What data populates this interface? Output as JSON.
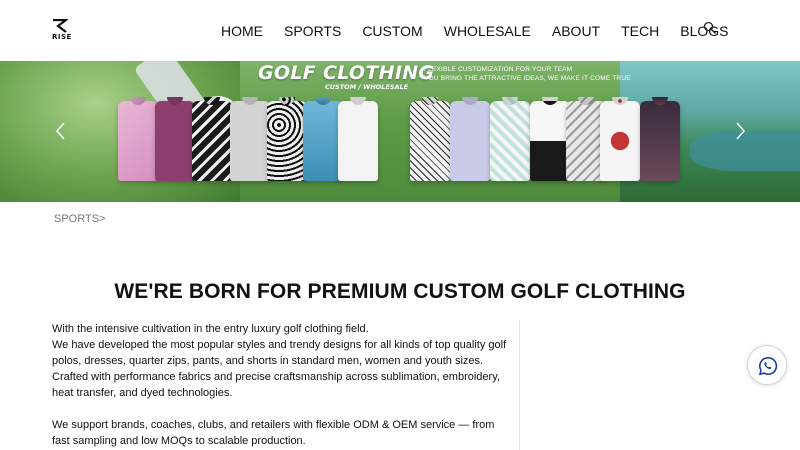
{
  "header": {
    "logo_text": "RISE",
    "nav": [
      "HOME",
      "SPORTS",
      "CUSTOM",
      "WHOLESALE",
      "ABOUT",
      "TECH",
      "BLOGS"
    ],
    "search_icon": "search-icon"
  },
  "banner": {
    "title": "GOLF CLOTHING",
    "subtitle": "CUSTOM / WHOLESALE",
    "tagline_1": "FLEXIBLE CUSTOMIZATION FOR YOUR TEAM",
    "tagline_2": "YOU BRING THE ATTRACTIVE IDEAS, WE MAKE IT COME TRUE",
    "prev_icon": "chevron-left-icon",
    "next_icon": "chevron-right-icon"
  },
  "breadcrumb": "SPORTS>",
  "main": {
    "title": "WE'RE BORN FOR PREMIUM CUSTOM GOLF CLOTHING",
    "paragraph_1_line_1": "With the intensive cultivation in the entry luxury golf clothing field.",
    "paragraph_1_line_2": "We have developed the most popular styles and trendy designs for all kinds of top quality golf polos, dresses, quarter zips, pants, and shorts in standard men, women and youth sizes.",
    "paragraph_1_line_3": "Crafted with performance fabrics and precise craftsmanship across sublimation, embroidery, heat transfer, and dyed technologies.",
    "paragraph_2": "We support brands, coaches, clubs, and retailers with flexible ODM & OEM service — from fast sampling and low MOQs to scalable production."
  },
  "floating": {
    "whatsapp_icon": "whatsapp-icon"
  },
  "colors": {
    "text": "#111111",
    "breadcrumb": "#777777",
    "whatsapp": "#1a3fa6"
  }
}
